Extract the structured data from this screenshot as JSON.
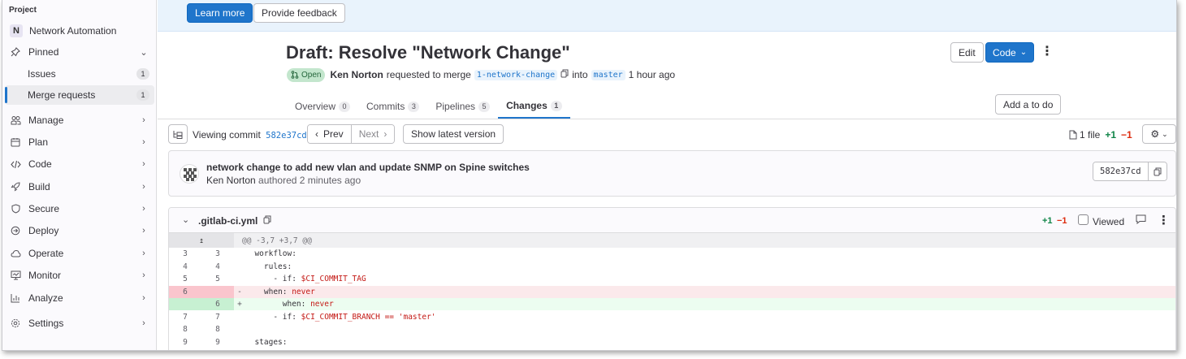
{
  "sidebar": {
    "section_label": "Project",
    "project": {
      "avatar": "N",
      "name": "Network Automation"
    },
    "pinned_label": "Pinned",
    "pinned_items": [
      {
        "label": "Issues",
        "count": "1"
      },
      {
        "label": "Merge requests",
        "count": "1"
      }
    ],
    "items": [
      {
        "label": "Manage",
        "icon": "users-icon"
      },
      {
        "label": "Plan",
        "icon": "calendar-icon"
      },
      {
        "label": "Code",
        "icon": "code-icon"
      },
      {
        "label": "Build",
        "icon": "rocket-icon"
      },
      {
        "label": "Secure",
        "icon": "shield-icon"
      },
      {
        "label": "Deploy",
        "icon": "deploy-icon"
      },
      {
        "label": "Operate",
        "icon": "cloud-icon"
      },
      {
        "label": "Monitor",
        "icon": "monitor-icon"
      },
      {
        "label": "Analyze",
        "icon": "chart-icon"
      },
      {
        "label": "Settings",
        "icon": "gear-icon"
      }
    ]
  },
  "banner": {
    "learn_more": "Learn more",
    "feedback": "Provide feedback"
  },
  "mr": {
    "title": "Draft: Resolve \"Network Change\"",
    "status": "Open",
    "author": "Ken Norton",
    "requested_text": "requested to merge",
    "source_branch": "1-network-change",
    "into_text": "into",
    "target_branch": "master",
    "time": "1 hour ago",
    "edit_label": "Edit",
    "code_label": "Code",
    "add_todo_label": "Add a to do"
  },
  "tabs": [
    {
      "label": "Overview",
      "count": "0",
      "active": false
    },
    {
      "label": "Commits",
      "count": "3",
      "active": false
    },
    {
      "label": "Pipelines",
      "count": "5",
      "active": false
    },
    {
      "label": "Changes",
      "count": "1",
      "active": true
    }
  ],
  "toolbar": {
    "viewing_label": "Viewing commit",
    "commit_sha": "582e37cd",
    "prev_label": "Prev",
    "next_label": "Next",
    "latest_label": "Show latest version",
    "files_label": "1 file",
    "additions": "+1",
    "deletions": "−1"
  },
  "commit": {
    "message": "network change to add new vlan and update SNMP on Spine switches",
    "author": "Ken Norton",
    "authored_text": "authored 2 minutes ago",
    "sha": "582e37cd"
  },
  "file": {
    "name": ".gitlab-ci.yml",
    "additions": "+1",
    "deletions": "−1",
    "viewed_label": "Viewed",
    "hunk_header": "@@ -3,7 +3,7 @@"
  },
  "diff_lines": [
    {
      "old": "3",
      "new": "3",
      "sign": "",
      "type": "context",
      "text": "  workflow:"
    },
    {
      "old": "4",
      "new": "4",
      "sign": "",
      "type": "context",
      "text": "    rules:"
    },
    {
      "old": "5",
      "new": "5",
      "sign": "",
      "type": "context",
      "text": "      - if: $CI_COMMIT_TAG"
    },
    {
      "old": "6",
      "new": "",
      "sign": "-",
      "type": "removed",
      "text": "    when: never"
    },
    {
      "old": "",
      "new": "6",
      "sign": "+",
      "type": "added",
      "text": "        when: never"
    },
    {
      "old": "7",
      "new": "7",
      "sign": "",
      "type": "context",
      "text": "      - if: $CI_COMMIT_BRANCH == 'master'"
    },
    {
      "old": "8",
      "new": "8",
      "sign": "",
      "type": "context",
      "text": ""
    },
    {
      "old": "9",
      "new": "9",
      "sign": "",
      "type": "context",
      "text": "  stages:"
    }
  ],
  "colors": {
    "accent": "#1f75cb",
    "added_bg": "#ecfdf0",
    "removed_bg": "#fbe9eb",
    "added_gutter": "#c7f0d2",
    "removed_gutter": "#fac5cd",
    "green": "#108548",
    "red": "#dd2b0e"
  }
}
